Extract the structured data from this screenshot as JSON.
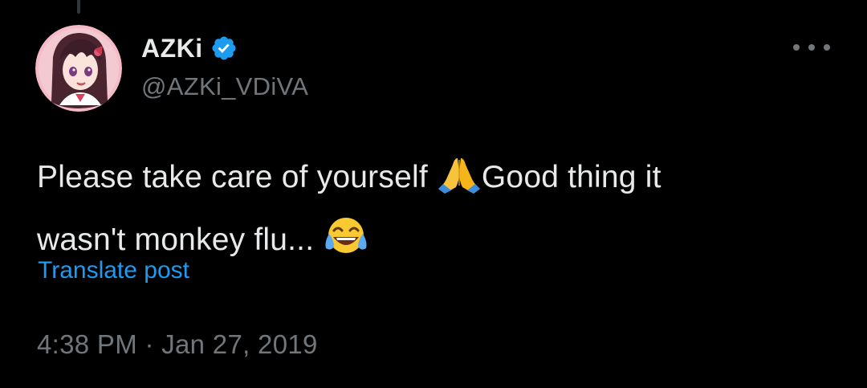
{
  "tweet": {
    "author": {
      "display_name": "AZKi",
      "handle": "@AZKi_VDiVA",
      "verified": true,
      "verified_color": "#1d9bf0",
      "avatar_icon": "avatar-anime-girl"
    },
    "more_menu_icon": "more-horizontal-icon",
    "text_line1_part1": "Please take care of yourself ",
    "emoji1": "folded-hands-emoji",
    "text_line1_part2": "Good thing it",
    "text_line2": "wasn't monkey flu... ",
    "emoji2": "tears-of-joy-emoji",
    "translate_label": "Translate post",
    "timestamp": "4:38 PM · Jan 27, 2019"
  },
  "colors": {
    "background": "#000000",
    "primary_text": "#e7e9ea",
    "secondary_text": "#71767b",
    "link": "#1d9bf0"
  }
}
